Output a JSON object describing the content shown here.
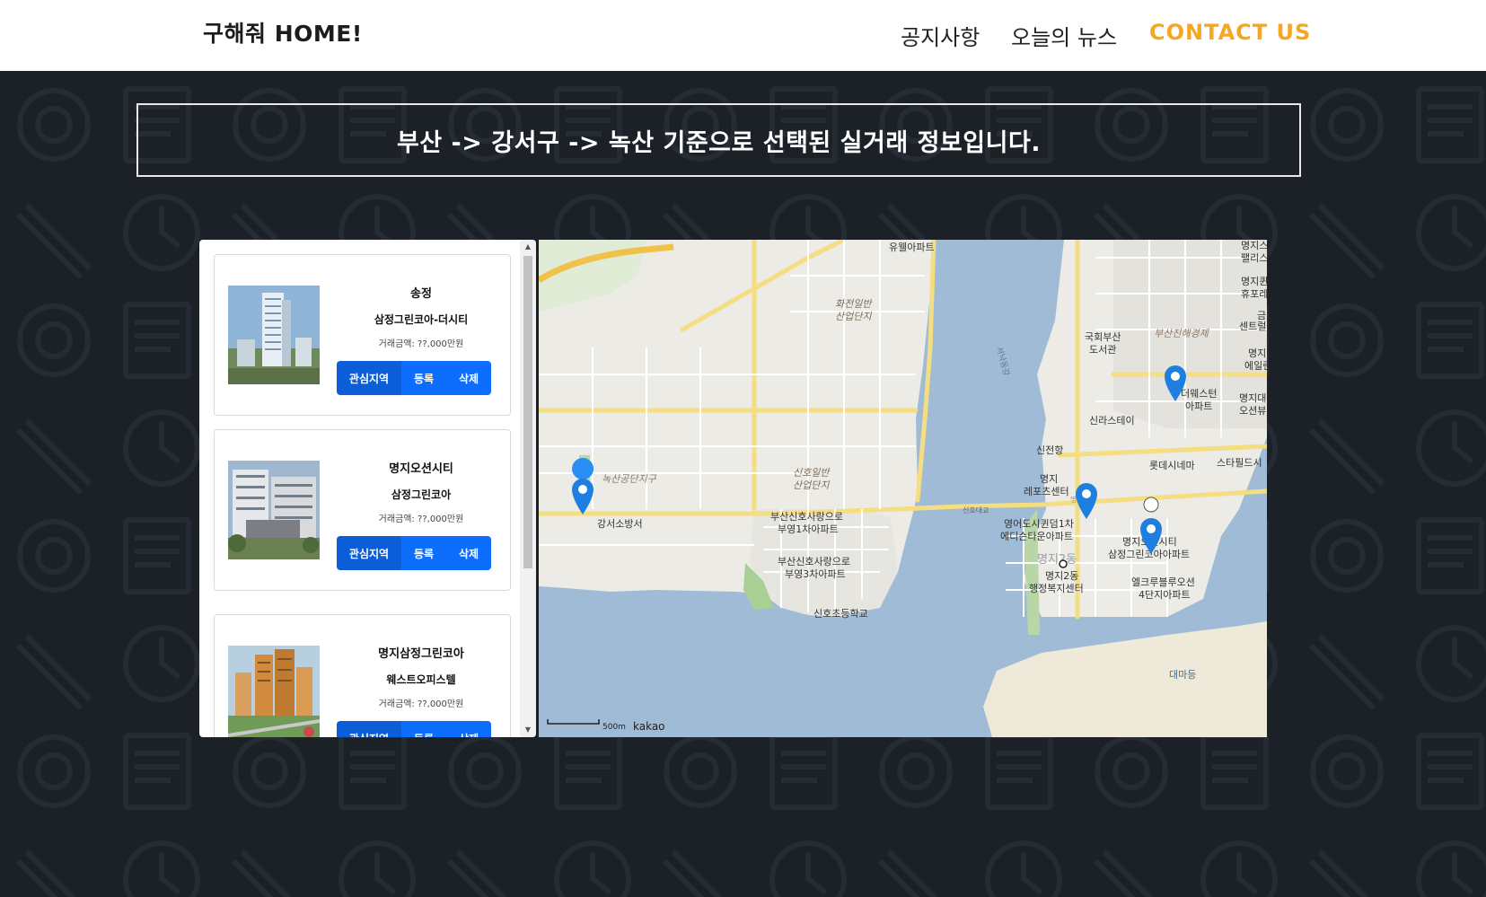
{
  "header": {
    "brand": "구해줘 HOME!",
    "nav": [
      {
        "label": "공지사항"
      },
      {
        "label": "오늘의 뉴스"
      },
      {
        "label": "CONTACT US"
      }
    ]
  },
  "banner": {
    "text": "부산 -> 강서구 -> 녹산 기준으로 선택된 실거래 정보입니다."
  },
  "listings": [
    {
      "name": "송정",
      "complex": "삼정그린코아-더시티",
      "price": "거래금액: ??,000만원",
      "buttons": [
        "관심지역",
        "등록",
        "삭제"
      ]
    },
    {
      "name": "명지오션시티",
      "complex": "삼정그린코아",
      "price": "거래금액: ??,000만원",
      "buttons": [
        "관심지역",
        "등록",
        "삭제"
      ]
    },
    {
      "name": "명지삼정그린코아",
      "complex": "웨스트오피스텔",
      "price": "거래금액: ??,000만원",
      "buttons": [
        "관심지역",
        "등록",
        "삭제"
      ]
    }
  ],
  "map": {
    "labels": {
      "yuwell": "유웰아파트",
      "hwajeon": "화전일반",
      "hwajeon2": "산업단지",
      "seonakdong": "서낙동강",
      "library": "국회부산",
      "library2": "도서관",
      "econ_zone": "부산진해경제",
      "myeongji_palace": "명지스",
      "palace2": "팰리스",
      "myeongji_hue": "명지퀸",
      "hue2": "휴포레아",
      "gum": "금",
      "center": "센트럴",
      "myeongji_el": "명지",
      "el2": "에일린",
      "the_west": "더웨스턴",
      "the_west2": "아파트",
      "myeongji_ocean": "명지대",
      "ocean2": "오션뷰",
      "shilla": "신라스테이",
      "lotte": "롯데시네마",
      "starbucks": "스타필드시",
      "sinjeon": "신전항",
      "leports": "명지",
      "leports2": "레포츠센터",
      "noksan": "녹산공단지구",
      "gangseo_fire": "강서소방서",
      "sinho_ind": "신호일반",
      "sinho_ind2": "산업단지",
      "sinho_apt1": "부산신호사랑으로",
      "sinho_apt1b": "부영1차아파트",
      "sinho_bridge": "신호대교",
      "yeongeo": "영어도시퀸덤1차",
      "yeongeo2": "에디슨타운아파트",
      "myeongji_oc": "명지오션시티",
      "myeongji_oc2": "삼정그린코아아파트",
      "sinho_apt3": "부산신호사랑으로",
      "sinho_apt3b": "부영3차아파트",
      "myeongji2dong_area": "명지2동",
      "myeongji2dong": "명지2동",
      "myeongji2dong2": "행정복지센터",
      "elc": "엘크루블루오션",
      "elc2": "4단지아파트",
      "sinho_school": "신호초등학교",
      "daemadeung": "대마등",
      "myeongji_ic": "명지IC",
      "ic": "IC"
    },
    "scale": "500m",
    "logo": "kakao"
  }
}
